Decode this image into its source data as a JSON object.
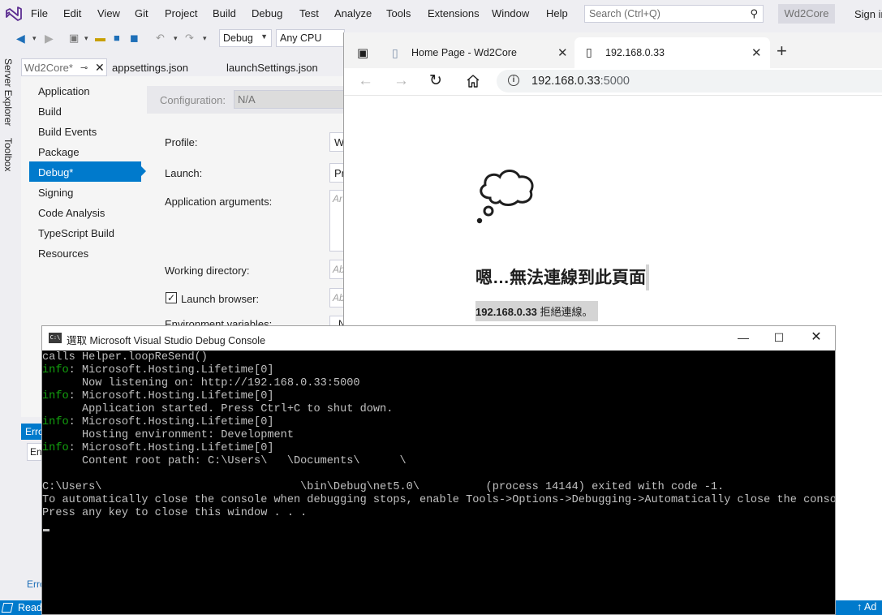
{
  "vs": {
    "menu": [
      "File",
      "Edit",
      "View",
      "Git",
      "Project",
      "Build",
      "Debug",
      "Test",
      "Analyze",
      "Tools",
      "Extensions",
      "Window",
      "Help"
    ],
    "search_placeholder": "Search (Ctrl+Q)",
    "solution_name": "Wd2Core",
    "sign_in": "Sign in",
    "toolbar": {
      "config": "Debug",
      "platform": "Any CPU"
    },
    "side_tabs": [
      "Server Explorer",
      "Toolbox"
    ],
    "doc_tabs": [
      "Wd2Core*",
      "appsettings.json",
      "launchSettings.json"
    ],
    "project_nav": [
      "Application",
      "Build",
      "Build Events",
      "Package",
      "Debug*",
      "Signing",
      "Code Analysis",
      "TypeScript Build",
      "Resources"
    ],
    "props": {
      "configuration_label": "Configuration:",
      "configuration_value": "N/A",
      "profile_label": "Profile:",
      "profile_value": "W",
      "launch_label": "Launch:",
      "launch_value": "Pr",
      "app_args_label": "Application arguments:",
      "app_args_placeholder": "Ar",
      "working_dir_label": "Working directory:",
      "working_dir_placeholder": "Ab",
      "launch_browser_label": "Launch browser:",
      "launch_browser_checked": true,
      "launch_browser_placeholder": "Ab",
      "env_vars_label": "Environment variables:",
      "env_vars_value": "N"
    },
    "error_list": {
      "tab": "Erro",
      "field": "En",
      "bottom_tab": "Erro"
    },
    "status": {
      "text": "Read",
      "right": "↑ Ad"
    }
  },
  "browser": {
    "tabs": [
      {
        "title": "Home Page - Wd2Core",
        "active": false
      },
      {
        "title": "192.168.0.33",
        "active": true
      }
    ],
    "address": {
      "host": "192.168.0.33",
      "port": ":5000"
    },
    "error_title": "嗯…無法連線到此頁面",
    "error_host": "192.168.0.33",
    "error_msg": " 拒絕連線。"
  },
  "console": {
    "title": "選取 Microsoft Visual Studio Debug Console",
    "lines": [
      {
        "prefix": "",
        "text": "calls Helper.loopReSend()"
      },
      {
        "prefix": "info",
        "text": ": Microsoft.Hosting.Lifetime[0]"
      },
      {
        "prefix": "",
        "text": "      Now listening on: http://192.168.0.33:5000"
      },
      {
        "prefix": "info",
        "text": ": Microsoft.Hosting.Lifetime[0]"
      },
      {
        "prefix": "",
        "text": "      Application started. Press Ctrl+C to shut down."
      },
      {
        "prefix": "info",
        "text": ": Microsoft.Hosting.Lifetime[0]"
      },
      {
        "prefix": "",
        "text": "      Hosting environment: Development"
      },
      {
        "prefix": "info",
        "text": ": Microsoft.Hosting.Lifetime[0]"
      },
      {
        "prefix": "",
        "text": "      Content root path: C:\\Users\\   \\Documents\\      \\        "
      },
      {
        "prefix": "",
        "text": ""
      },
      {
        "prefix": "",
        "text": "C:\\Users\\                              \\bin\\Debug\\net5.0\\          (process 14144) exited with code -1."
      },
      {
        "prefix": "",
        "text": "To automatically close the console when debugging stops, enable Tools->Options->Debugging->Automatically close the console"
      },
      {
        "prefix": "",
        "text": "Press any key to close this window . . ."
      }
    ]
  },
  "colors": {
    "vs_accent": "#007acc",
    "console_bg": "#000000",
    "console_fg": "#c0c0c0",
    "console_info": "#13a10e"
  }
}
